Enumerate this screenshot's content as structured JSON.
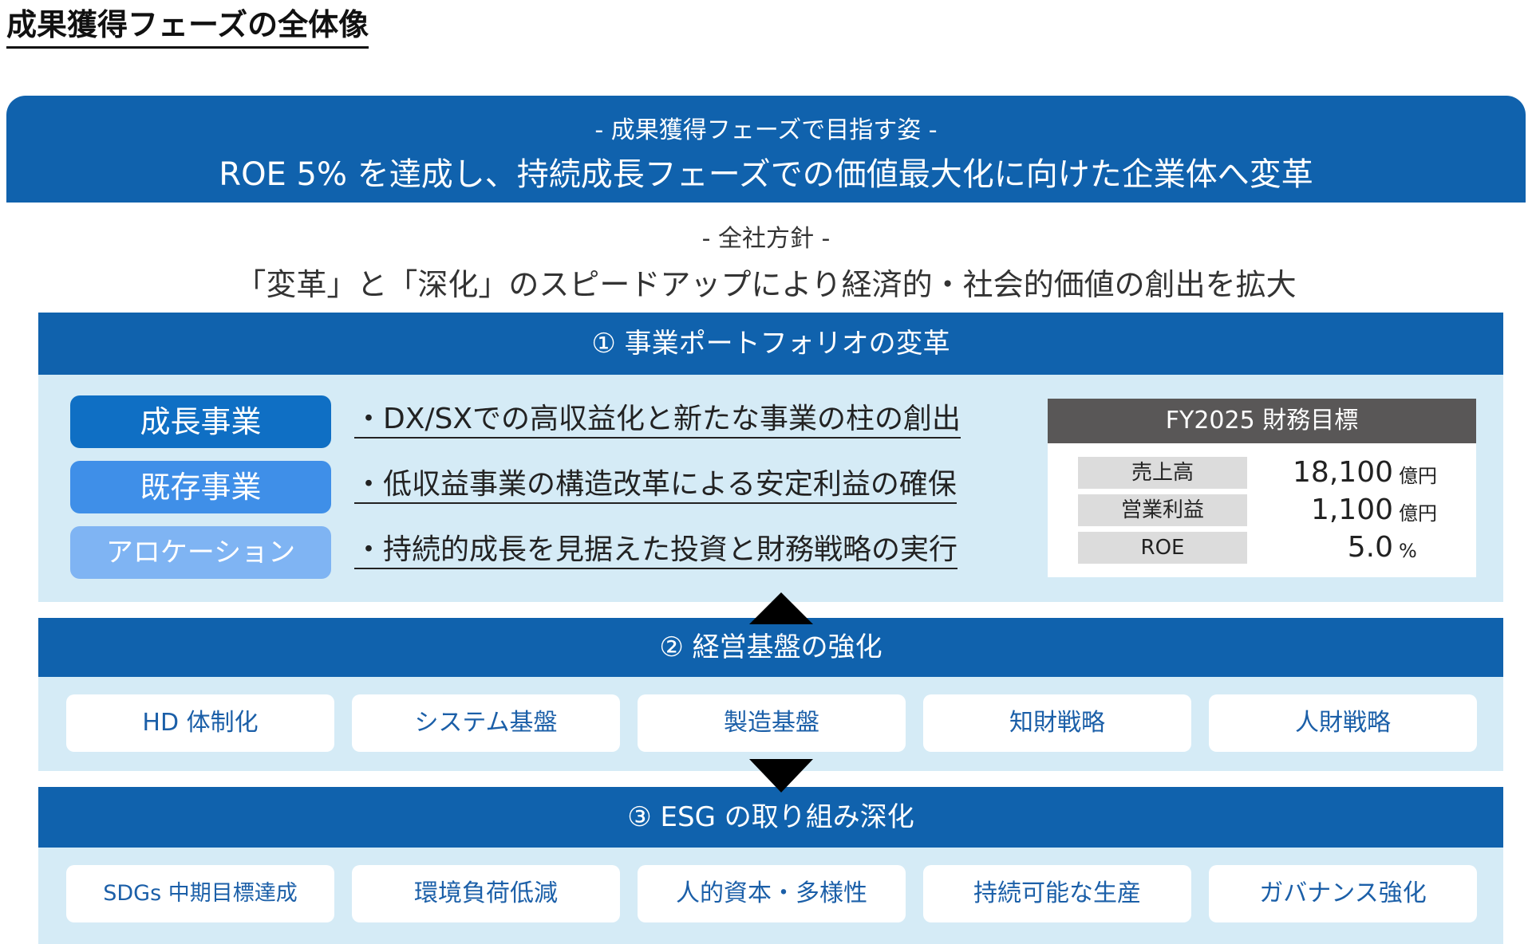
{
  "title": "成果獲得フェーズの全体像",
  "vision": {
    "label": "- 成果獲得フェーズで目指す姿 -",
    "text": "ROE 5% を達成し、持続成長フェーズでの価値最大化に向けた企業体へ変革"
  },
  "policy": {
    "label": "- 全社方針 -",
    "text": "「変革」と「深化」のスピードアップにより経済的・社会的価値の創出を拡大"
  },
  "section1": {
    "header": "① 事業ポートフォリオの変革",
    "segments": [
      {
        "label": "成長事業",
        "text": "・DX/SXでの高収益化と新たな事業の柱の創出"
      },
      {
        "label": "既存事業",
        "text": "・低収益事業の構造改革による安定利益の確保"
      },
      {
        "label": "アロケーション",
        "text": "・持続的成長を見据えた投資と財務戦略の実行"
      }
    ],
    "targets": {
      "title": "FY2025 財務目標",
      "rows": [
        {
          "label": "売上高",
          "value": "18,100",
          "unit": "億円"
        },
        {
          "label": "営業利益",
          "value": "1,100",
          "unit": "億円"
        },
        {
          "label": "ROE",
          "value": "5.0",
          "unit": "%"
        }
      ]
    }
  },
  "section2": {
    "header": "② 経営基盤の強化",
    "items": [
      "HD 体制化",
      "システム基盤",
      "製造基盤",
      "知財戦略",
      "人財戦略"
    ]
  },
  "section3": {
    "header": "③ ESG の取り組み深化",
    "items": [
      "SDGs 中期目標達成",
      "環境負荷低減",
      "人的資本・多様性",
      "持続可能な生産",
      "ガバナンス強化"
    ]
  }
}
